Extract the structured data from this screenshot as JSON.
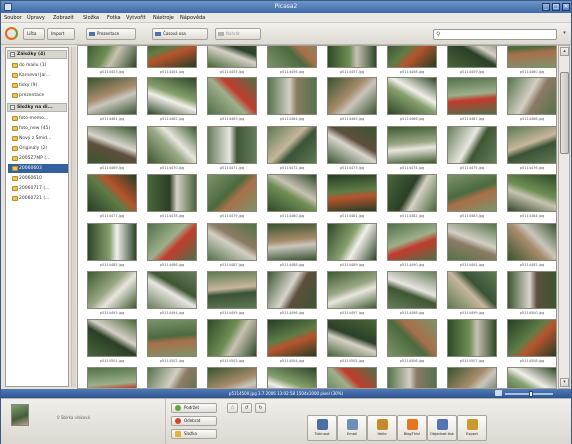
{
  "window": {
    "title": "Picasa2"
  },
  "menu": [
    "Soubor",
    "Úpravy",
    "Zobrazit",
    "Složka",
    "Fotka",
    "Vytvořit",
    "Nástroje",
    "Nápověda"
  ],
  "toolbar": {
    "buttons": [
      "Lišta",
      "Import",
      "Prezentace",
      "Časová osa",
      "Nahrát"
    ],
    "search_placeholder": ""
  },
  "sidebar": {
    "groups": [
      {
        "label": "Záložky (4)",
        "expanded": true,
        "items": [
          {
            "label": "do mailu (1)",
            "selected": false
          },
          {
            "label": "Karneval Jar...",
            "selected": false
          },
          {
            "label": "tisky (9)",
            "selected": false
          },
          {
            "label": "prezentace",
            "selected": false
          }
        ]
      },
      {
        "label": "Složky na di...",
        "expanded": true,
        "items": [
          {
            "label": "foto-memo...",
            "selected": false
          },
          {
            "label": "foto_new (45)",
            "selected": false
          },
          {
            "label": "Nový z Šmid...",
            "selected": false
          },
          {
            "label": "Originály (2)",
            "selected": false
          },
          {
            "label": "2005Z7MP (...",
            "selected": false
          },
          {
            "label": "20060603",
            "selected": true
          },
          {
            "label": "20060610",
            "selected": false
          },
          {
            "label": "20060717 (...",
            "selected": false
          },
          {
            "label": "20060721 (...",
            "selected": false
          }
        ]
      }
    ]
  },
  "gallery": {
    "rows": [
      [
        "p5114453.jpg",
        "p5114454.jpg",
        "p5114455.jpg",
        "p5114456.jpg",
        "p5114457.jpg",
        "p5114458.jpg",
        "p5114459.jpg",
        "p5114460.jpg"
      ],
      [
        "p5114461.jpg",
        "p5114462.jpg",
        "p5114463.jpg",
        "p5114464.jpg",
        "p5114465.jpg",
        "p5114466.jpg",
        "p5114467.jpg",
        "p5114468.jpg"
      ],
      [
        "p5114469.jpg",
        "p5114470.jpg",
        "p5114471.jpg",
        "p5114472.jpg",
        "p5114473.jpg",
        "p5114474.jpg",
        "p5114475.jpg",
        "p5114476.jpg"
      ],
      [
        "p5114477.jpg",
        "p5114478.jpg",
        "p5114479.jpg",
        "p5114480.jpg",
        "p5114481.jpg",
        "p5114482.jpg",
        "p5114483.jpg",
        "p5114484.jpg"
      ],
      [
        "p5114485.jpg",
        "p5114486.jpg",
        "p5114487.jpg",
        "p5114488.jpg",
        "p5114489.jpg",
        "p5114490.jpg",
        "p5114491.jpg",
        "p5114492.jpg"
      ],
      [
        "p5114493.jpg",
        "p5114494.jpg",
        "p5114495.jpg",
        "p5114496.jpg",
        "p5114497.jpg",
        "p5114498.jpg",
        "p5114499.jpg",
        "p5114500.jpg"
      ],
      [
        "p5114501.jpg",
        "p5114502.jpg",
        "p5114503.jpg",
        "p5114504.jpg",
        "p5114505.jpg",
        "p5114506.jpg",
        "p5114507.jpg",
        "p5114508.jpg"
      ],
      [
        "",
        "",
        "",
        "",
        "",
        "",
        "",
        ""
      ]
    ],
    "scroll_position": 0.05
  },
  "status": {
    "text": "p5114500.jpg   3.7.2006 13:02:58   1504x1000 pixel (30%)",
    "zoom_level": 0.55
  },
  "tray": {
    "text": "0 Sbírka vlaková",
    "buttons": [
      "Podržet",
      "Odebrat",
      "Složka"
    ]
  },
  "actions": [
    {
      "label": "Tisknout",
      "icon": "printer-icon",
      "color": "#4b6f9e"
    },
    {
      "label": "Email",
      "icon": "email-icon",
      "color": "#6d8fb8"
    },
    {
      "label": "Hello",
      "icon": "chat-icon",
      "color": "#c48a2a"
    },
    {
      "label": "BlogThis!",
      "icon": "blogger-icon",
      "color": "#e5761f"
    },
    {
      "label": "Objednat tisk",
      "icon": "order-prints-icon",
      "color": "#5474b0"
    },
    {
      "label": "Export",
      "icon": "export-icon",
      "color": "#c99a2c"
    }
  ],
  "colors": {
    "selection": "#34609c",
    "status_bar": "#2d5592"
  }
}
